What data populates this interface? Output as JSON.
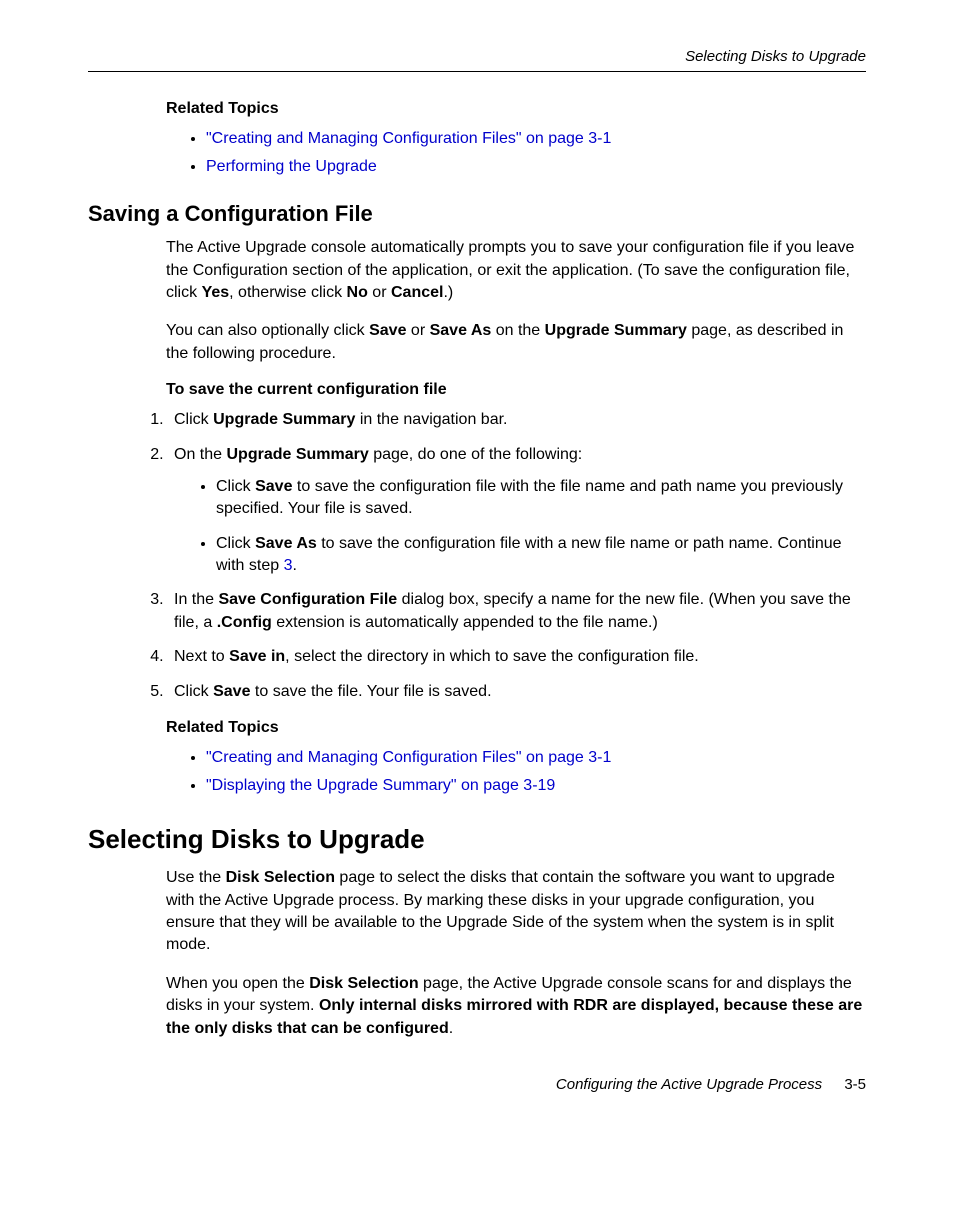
{
  "runningHead": "Selecting Disks to Upgrade",
  "relatedTopics1": {
    "heading": "Related Topics",
    "items": [
      "\"Creating and Managing Configuration Files\" on page 3-1",
      "Performing the Upgrade"
    ]
  },
  "section1": {
    "heading": "Saving a Configuration File",
    "para1_pre": "The Active Upgrade console automatically prompts you to save your configuration file if you leave the Configuration section of the application, or exit the application. (To save the configuration file, click ",
    "para1_b1": "Yes",
    "para1_mid1": ", otherwise click ",
    "para1_b2": "No",
    "para1_mid2": " or ",
    "para1_b3": "Cancel",
    "para1_post": ".)",
    "para2_pre": "You can also optionally click ",
    "para2_b1": "Save",
    "para2_mid1": " or ",
    "para2_b2": "Save As",
    "para2_mid2": " on the ",
    "para2_b3": "Upgrade Summary",
    "para2_post": " page, as described in the following procedure.",
    "procHeading": "To save the current configuration file",
    "step1_pre": "Click ",
    "step1_b": "Upgrade Summary",
    "step1_post": " in the navigation bar.",
    "step2_pre": "On the ",
    "step2_b": "Upgrade Summary",
    "step2_post": " page, do one of the following:",
    "bulletA_pre": "Click ",
    "bulletA_b": "Save",
    "bulletA_post": " to save the configuration file with the file name and path name you previously specified. Your file is saved.",
    "bulletB_pre": "Click ",
    "bulletB_b": "Save As",
    "bulletB_post1": " to save the configuration file with a new file name or path name. Continue with step ",
    "bulletB_link": "3",
    "bulletB_post2": ".",
    "step3_pre": "In the ",
    "step3_b1": "Save Configuration File",
    "step3_mid": " dialog box, specify a name for the new file. (When you save the file, a ",
    "step3_b2": ".Config",
    "step3_post": " extension is automatically appended to the file name.)",
    "step4_pre": "Next to ",
    "step4_b": "Save in",
    "step4_post": ", select the directory in which to save the configuration file.",
    "step5_pre": "Click ",
    "step5_b": "Save",
    "step5_post": " to save the file. Your file is saved."
  },
  "relatedTopics2": {
    "heading": "Related Topics",
    "items": [
      "\"Creating and Managing Configuration Files\" on page 3-1",
      "\"Displaying the Upgrade Summary\" on page 3-19"
    ]
  },
  "section2": {
    "heading": "Selecting Disks to Upgrade",
    "para1_pre": "Use the ",
    "para1_b": "Disk Selection",
    "para1_post": " page to select the disks that contain the software you want to upgrade with the Active Upgrade process. By marking these disks in your upgrade configuration, you ensure that they will be available to the Upgrade Side of the system when the system is in split mode.",
    "para2_pre": "When you open the ",
    "para2_b1": "Disk Selection",
    "para2_mid": " page, the Active Upgrade console scans for and displays the disks in your system. ",
    "para2_b2": "Only internal disks mirrored with RDR are displayed, because these are the only disks that can be configured",
    "para2_post": "."
  },
  "footer": {
    "chapter": "Configuring the Active Upgrade Process",
    "page": "3-5"
  }
}
